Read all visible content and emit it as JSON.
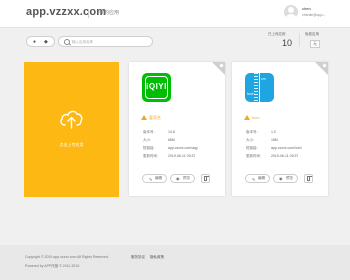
{
  "header": {
    "logo": "app.vzzxx.com",
    "nav_label": "我的应用",
    "user_name": "chen",
    "user_email": "chenlie@qq.c..."
  },
  "toolbar": {
    "platform_apple_icon": "apple-icon",
    "platform_android_icon": "android-icon",
    "search_placeholder": "输入应用名称",
    "uploads_label": "已上传应用",
    "uploads_count": "10",
    "quota_label": "免费应用",
    "quota_value": "无"
  },
  "upload_card": {
    "label": "点击上传应用",
    "color": "#fdb814"
  },
  "apps": [
    {
      "name": "爱奇艺",
      "icon": "iqiyi-icon",
      "icon_text": "iQIYI",
      "info": [
        {
          "label": "版本号:",
          "value": "10.8"
        },
        {
          "label": "大小:",
          "value": "66M"
        },
        {
          "label": "短链接:",
          "value": "app.vzzxx.com/aqy"
        },
        {
          "label": "更新时间:",
          "value": "2019-06-11 09:37"
        }
      ],
      "edit_label": "编辑",
      "preview_label": "预览"
    },
    {
      "name": "Inch",
      "icon": "inch-ruler-icon",
      "icon_text": "Inch",
      "icon_text2": "cm",
      "info": [
        {
          "label": "版本号:",
          "value": "1.0"
        },
        {
          "label": "大小:",
          "value": "18M"
        },
        {
          "label": "短链接:",
          "value": "app.vzzxx.com/inch"
        },
        {
          "label": "更新时间:",
          "value": "2019-06-11 09:37"
        }
      ],
      "edit_label": "编辑",
      "preview_label": "预览"
    }
  ],
  "footer": {
    "copyright": "Copyright © 2019 app.vzzxx.com All Rights Reserved.",
    "link1": "服务协议",
    "link2": "隐私政策",
    "powered": "Powered by APP托管 © 2011-2019"
  }
}
